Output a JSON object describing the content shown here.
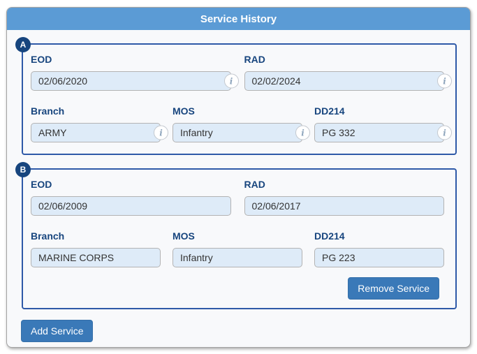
{
  "header": {
    "title": "Service History"
  },
  "sections": [
    {
      "badge": "A",
      "eod_label": "EOD",
      "eod_value": "02/06/2020",
      "rad_label": "RAD",
      "rad_value": "02/02/2024",
      "branch_label": "Branch",
      "branch_value": "ARMY",
      "mos_label": "MOS",
      "mos_value": "Infantry",
      "dd214_label": "DD214",
      "dd214_value": "PG 332"
    },
    {
      "badge": "B",
      "eod_label": "EOD",
      "eod_value": "02/06/2009",
      "rad_label": "RAD",
      "rad_value": "02/06/2017",
      "branch_label": "Branch",
      "branch_value": "MARINE CORPS",
      "mos_label": "MOS",
      "mos_value": "Infantry",
      "dd214_label": "DD214",
      "dd214_value": "PG 223",
      "remove_button_label": "Remove Service"
    }
  ],
  "buttons": {
    "add_service_label": "Add Service"
  },
  "icons": {
    "info": "i"
  },
  "colors": {
    "header_bg": "#5b9bd5",
    "section_border": "#2e59a8",
    "badge_bg": "#17457e",
    "label_color": "#17457e",
    "input_bg": "#deebf8",
    "button_bg": "#3a79b8"
  }
}
